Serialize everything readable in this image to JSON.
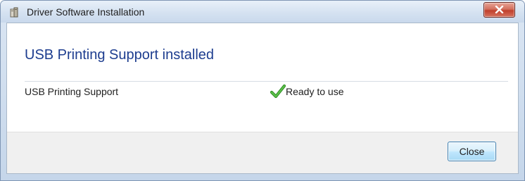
{
  "window": {
    "title": "Driver Software Installation",
    "icon": "driver-install-icon",
    "close_icon": "close-icon"
  },
  "main": {
    "heading": "USB Printing Support installed",
    "devices": [
      {
        "name": "USB Printing Support",
        "status": "Ready to use",
        "status_icon": "checkmark-icon",
        "status_color": "#3aa12f"
      }
    ]
  },
  "footer": {
    "close_label": "Close"
  },
  "colors": {
    "heading": "#1d3d8f",
    "close_x": "#c0402c",
    "button_border": "#3c7fb1"
  }
}
